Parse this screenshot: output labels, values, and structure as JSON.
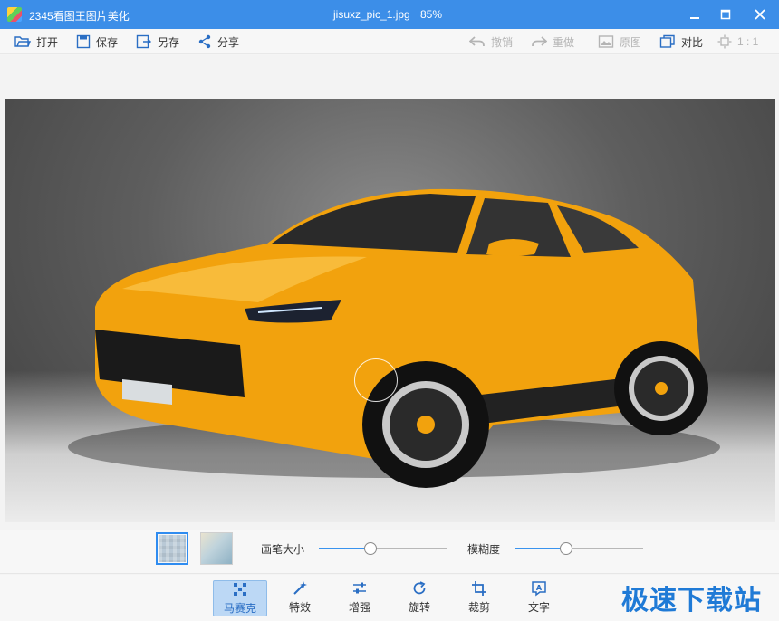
{
  "window": {
    "app_title": "2345看图王图片美化",
    "file_name": "jisuxz_pic_1.jpg",
    "zoom": "85%",
    "icons": {
      "minimize": "minimize-icon",
      "maximize": "maximize-icon",
      "close": "close-icon"
    }
  },
  "toolbar": {
    "open": "打开",
    "save": "保存",
    "save_as": "另存",
    "share": "分享",
    "undo": "撤销",
    "redo": "重做",
    "original": "原图",
    "compare": "对比",
    "ratio": "1 : 1"
  },
  "mosaic": {
    "brush_size_label": "画笔大小",
    "brush_size_value": 0.4,
    "blur_label": "模糊度",
    "blur_value": 0.4
  },
  "tools": [
    "马赛克",
    "特效",
    "增强",
    "旋转",
    "裁剪",
    "文字"
  ],
  "active_tool": "马赛克",
  "watermark": "极速下载站",
  "colors": {
    "accent": "#3c8ee8",
    "car": "#f2a20d"
  }
}
